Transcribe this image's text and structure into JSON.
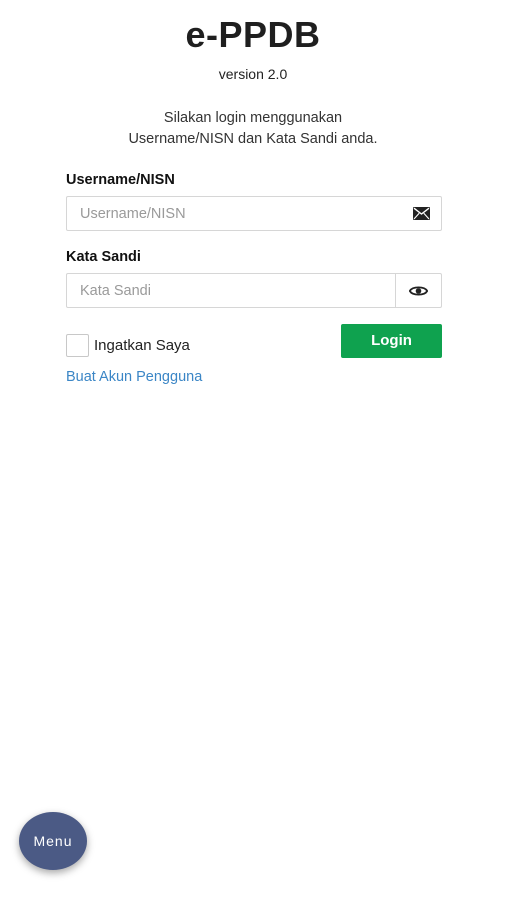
{
  "header": {
    "title": "e-PPDB",
    "version": "version 2.0",
    "intro_line1": "Silakan login menggunakan",
    "intro_line2": "Username/NISN dan Kata Sandi anda."
  },
  "form": {
    "username": {
      "label": "Username/NISN",
      "placeholder": "Username/NISN",
      "value": "",
      "icon": "envelope-icon"
    },
    "password": {
      "label": "Kata Sandi",
      "placeholder": "Kata Sandi",
      "value": "",
      "icon": "eye-icon"
    },
    "remember": {
      "label": "Ingatkan Saya",
      "checked": false
    },
    "login_label": "Login",
    "create_account_label": "Buat Akun Pengguna"
  },
  "menu": {
    "label": "Menu"
  },
  "colors": {
    "login_button": "#0fa24f",
    "link": "#3b86c6",
    "menu_fab": "#4b5a85"
  }
}
